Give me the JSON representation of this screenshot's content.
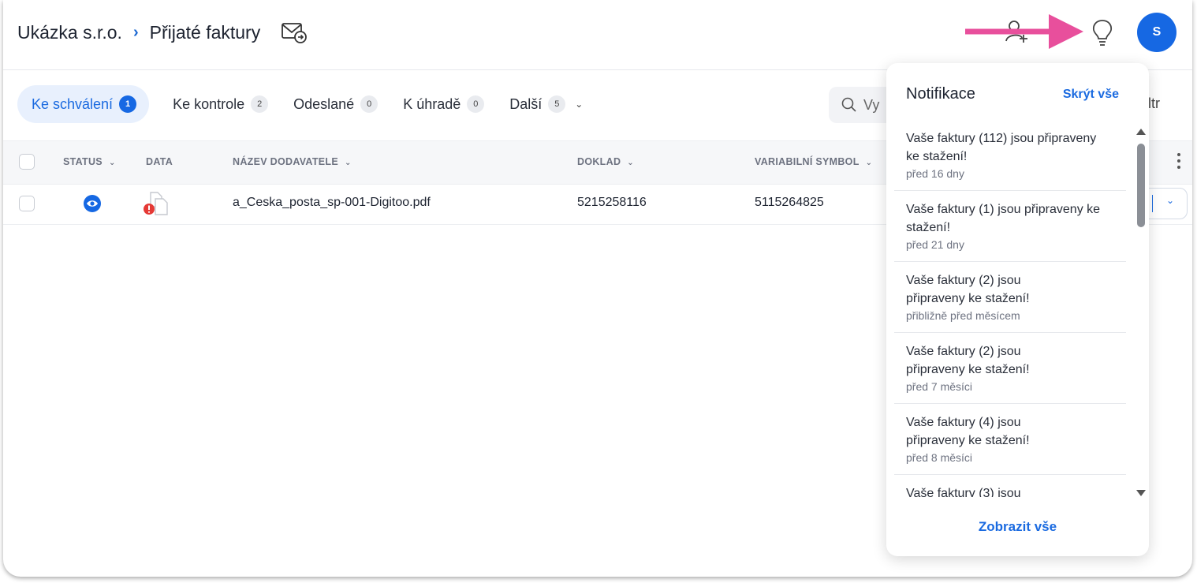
{
  "breadcrumb": {
    "company": "Ukázka s.r.o.",
    "separator": "›",
    "page": "Přijaté faktury"
  },
  "header": {
    "avatar_letter": "S"
  },
  "tabs": [
    {
      "label": "Ke schválení",
      "count": "1",
      "active": true
    },
    {
      "label": "Ke kontrole",
      "count": "2"
    },
    {
      "label": "Odeslané",
      "count": "0"
    },
    {
      "label": "K úhradě",
      "count": "0"
    },
    {
      "label": "Další",
      "count": "5"
    }
  ],
  "search": {
    "placeholder": "Vy"
  },
  "filter": {
    "label": "ltr"
  },
  "table": {
    "columns": [
      "STATUS",
      "DATA",
      "NÁZEV DODAVATELE",
      "DOKLAD",
      "VARIABILNÍ SYMBOL"
    ],
    "rows": [
      {
        "supplier": "a_Ceska_posta_sp-001-Digitoo.pdf",
        "document": "5215258116",
        "variable_symbol": "5115264825"
      }
    ]
  },
  "notifications": {
    "title": "Notifikace",
    "hide_all": "Skrýt vše",
    "show_all": "Zobrazit vše",
    "items": [
      {
        "message": "Vaše faktury (112) jsou připraveny ke stažení!",
        "time": "před 16 dny"
      },
      {
        "message": "Vaše faktury (1) jsou připraveny ke stažení!",
        "time": "před 21 dny"
      },
      {
        "message": "Vaše faktury (2) jsou připraveny ke stažení!",
        "time": "přibližně před měsícem"
      },
      {
        "message": "Vaše faktury (2) jsou připraveny ke stažení!",
        "time": "před 7 měsíci"
      },
      {
        "message": "Vaše faktury (4) jsou připraveny ke stažení!",
        "time": "před 8 měsíci"
      },
      {
        "message": "Vaše faktury (3) jsou",
        "time": ""
      }
    ]
  },
  "colors": {
    "accent": "#1a6ae0",
    "arrow": "#e84f9c",
    "error": "#e53935"
  }
}
